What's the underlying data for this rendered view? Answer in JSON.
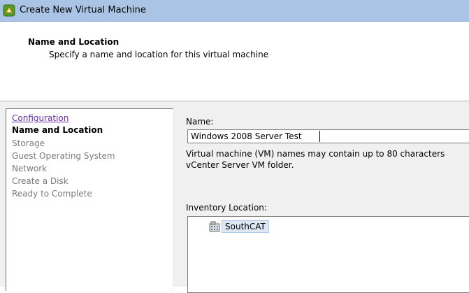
{
  "window": {
    "title": "Create New Virtual Machine"
  },
  "header": {
    "title": "Name and Location",
    "subtitle": "Specify a name and location for this virtual machine"
  },
  "nav": {
    "items": [
      {
        "label": "Configuration",
        "state": "visited"
      },
      {
        "label": "Name and Location",
        "state": "current"
      },
      {
        "label": "Storage",
        "state": "pending"
      },
      {
        "label": "Guest Operating System",
        "state": "pending"
      },
      {
        "label": "Network",
        "state": "pending"
      },
      {
        "label": "Create a Disk",
        "state": "pending"
      },
      {
        "label": "Ready to Complete",
        "state": "pending"
      }
    ]
  },
  "form": {
    "name_label": "Name:",
    "name_value": "Windows 2008 Server Test",
    "help_line1": "Virtual machine (VM) names may contain up to 80 characters",
    "help_line2": "vCenter Server VM folder.",
    "inventory_label": "Inventory Location:",
    "tree": [
      {
        "label": "SouthCAT",
        "icon": "datacenter-icon",
        "selected": true
      }
    ]
  }
}
